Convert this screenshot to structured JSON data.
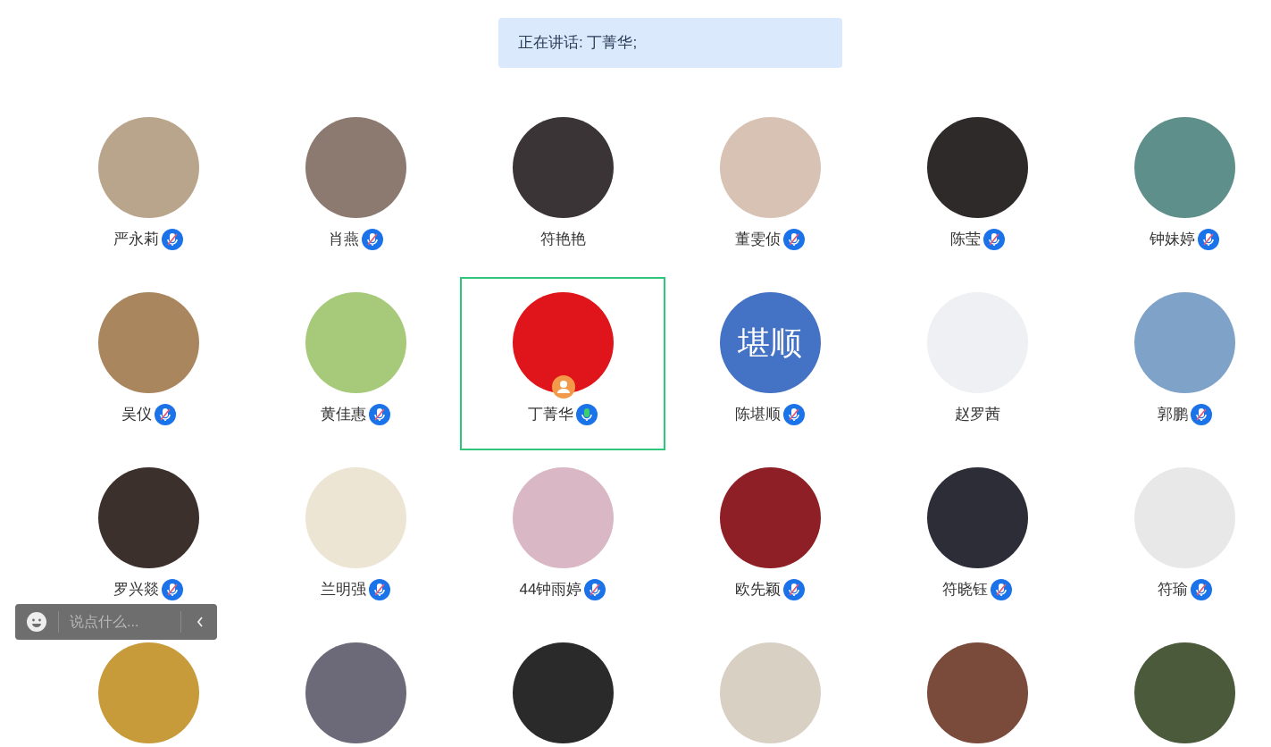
{
  "speaking_banner": {
    "text": "正在讲话: 丁菁华;"
  },
  "participants": [
    {
      "name": "严永莉",
      "muted": true,
      "speaking": false,
      "host": false
    },
    {
      "name": "肖燕",
      "muted": true,
      "speaking": false,
      "host": false
    },
    {
      "name": "符艳艳",
      "speaking": false,
      "host": false
    },
    {
      "name": "董雯侦",
      "muted": true,
      "speaking": false,
      "host": false
    },
    {
      "name": "陈莹",
      "muted": true,
      "speaking": false,
      "host": false
    },
    {
      "name": "钟妹婷",
      "muted": true,
      "speaking": false,
      "host": false
    },
    {
      "name": "吴仪",
      "muted": true,
      "speaking": false,
      "host": false
    },
    {
      "name": "黄佳惠",
      "muted": true,
      "speaking": false,
      "host": false
    },
    {
      "name": "丁菁华",
      "muted": false,
      "speaking": true,
      "host": true
    },
    {
      "name": "陈堪顺",
      "muted": true,
      "speaking": false,
      "host": false,
      "avatar_text": "堪顺"
    },
    {
      "name": "赵罗茜",
      "speaking": false,
      "host": false
    },
    {
      "name": "郭鹏",
      "muted": true,
      "speaking": false,
      "host": false
    },
    {
      "name": "罗兴燚",
      "muted": true,
      "speaking": false,
      "host": false
    },
    {
      "name": "兰明强",
      "muted": true,
      "speaking": false,
      "host": false
    },
    {
      "name": "44钟雨婷",
      "muted": true,
      "speaking": false,
      "host": false
    },
    {
      "name": "欧先颖",
      "muted": true,
      "speaking": false,
      "host": false
    },
    {
      "name": "符晓钰",
      "muted": true,
      "speaking": false,
      "host": false
    },
    {
      "name": "符瑜",
      "muted": true,
      "speaking": false,
      "host": false
    },
    {
      "speaking": false,
      "host": false
    },
    {
      "speaking": false,
      "host": false
    },
    {
      "speaking": false,
      "host": false
    },
    {
      "speaking": false,
      "host": false
    },
    {
      "speaking": false,
      "host": false
    },
    {
      "speaking": false,
      "host": false
    }
  ],
  "chat_bar": {
    "placeholder": "说点什么..."
  }
}
